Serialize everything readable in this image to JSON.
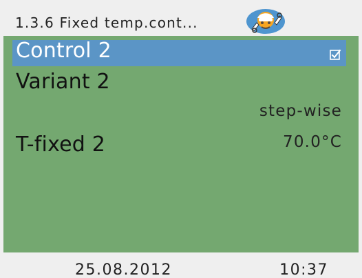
{
  "header": {
    "title": "1.3.6 Fixed temp.cont...",
    "mode_icon": "service-technician-icon"
  },
  "menu": {
    "items": [
      {
        "label": "Control 2",
        "selected": true,
        "icon": "checked-checkbox-icon",
        "checked": true
      },
      {
        "label": "Variant 2",
        "value": "step-wise"
      },
      {
        "label": "T-fixed 2",
        "value": "70.0°C"
      }
    ]
  },
  "footer": {
    "date": "25.08.2012",
    "time": "10:37"
  },
  "colors": {
    "background": "#efefef",
    "menu_background": "#74a870",
    "selected_row": "#5b95c6",
    "selected_text": "#ffffff",
    "icon_blue": "#4e95cf",
    "icon_orange": "#f6a521"
  }
}
